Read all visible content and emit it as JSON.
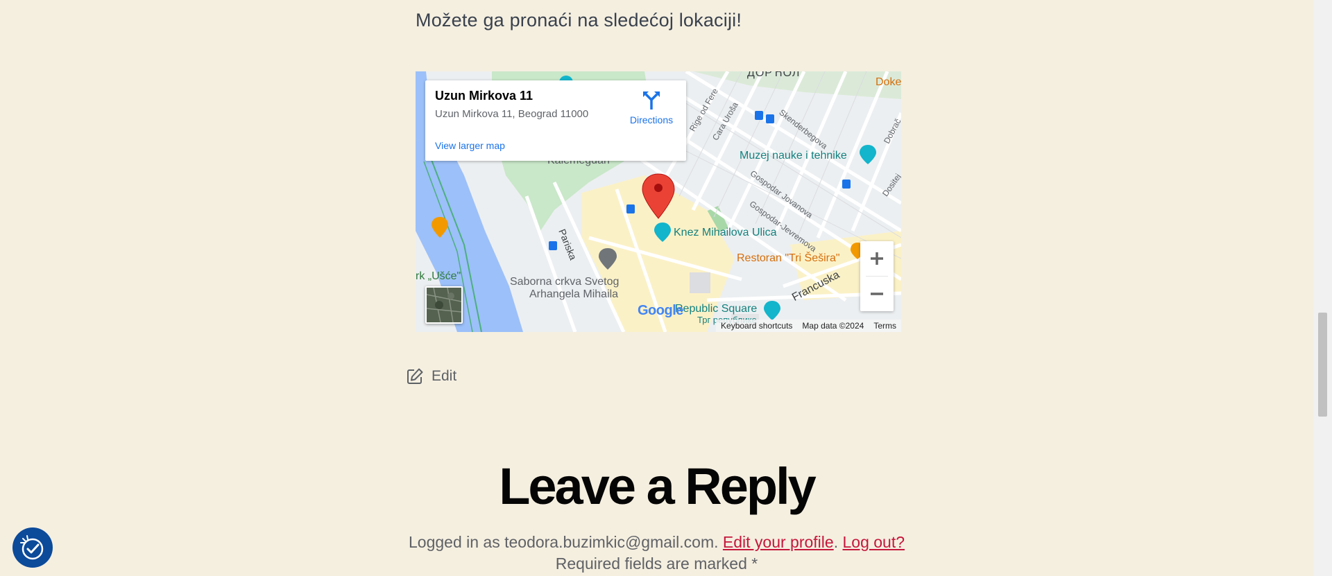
{
  "intro_text": "Možete ga pronaći na sledećoj lokaciji!",
  "map": {
    "info_title": "Uzun Mirkova 11",
    "info_address": "Uzun Mirkova 11, Beograd 11000",
    "directions_label": "Directions",
    "view_larger_label": "View larger map",
    "labels": {
      "dorcol": "ДОРЋОЛ",
      "doke": "Doke",
      "muzej": "Muzej nauke i tehnike",
      "kalemegdan": "Kalemegdan",
      "knez": "Knez Mihailova Ulica",
      "restoran": "Restoran \"Tri Šešira\"",
      "usce": "rk „Ušće\"",
      "saborna1": "Saborna crkva Svetog",
      "saborna2": "Arhangela Mihaila",
      "republic": "Republic Square",
      "republic_cyr": "Трг републике",
      "francuska": "Francuska",
      "pariska": "Pariska",
      "skenderbegova": "Skenderbegova",
      "cara_urosa": "Cara Uroša",
      "rige_od_fere": "Rige od Fere",
      "gospodar_jovanova": "Gospodar Jovanova",
      "gospodar_jevremova": "Gospodar-Jevremova",
      "dobracina": "Dobrač",
      "dositejeva": "Dositej"
    },
    "google_logo": "Google",
    "attribution": [
      "Keyboard shortcuts",
      "Map data ©2024",
      "Terms"
    ]
  },
  "edit_label": "Edit",
  "reply": {
    "title": "Leave a Reply",
    "logged_prefix": "Logged in as teodora.buzimkic@gmail.com.",
    "edit_profile": "Edit your profile",
    "separator": ".",
    "logout": "Log out?",
    "required": "Required fields are marked *"
  }
}
